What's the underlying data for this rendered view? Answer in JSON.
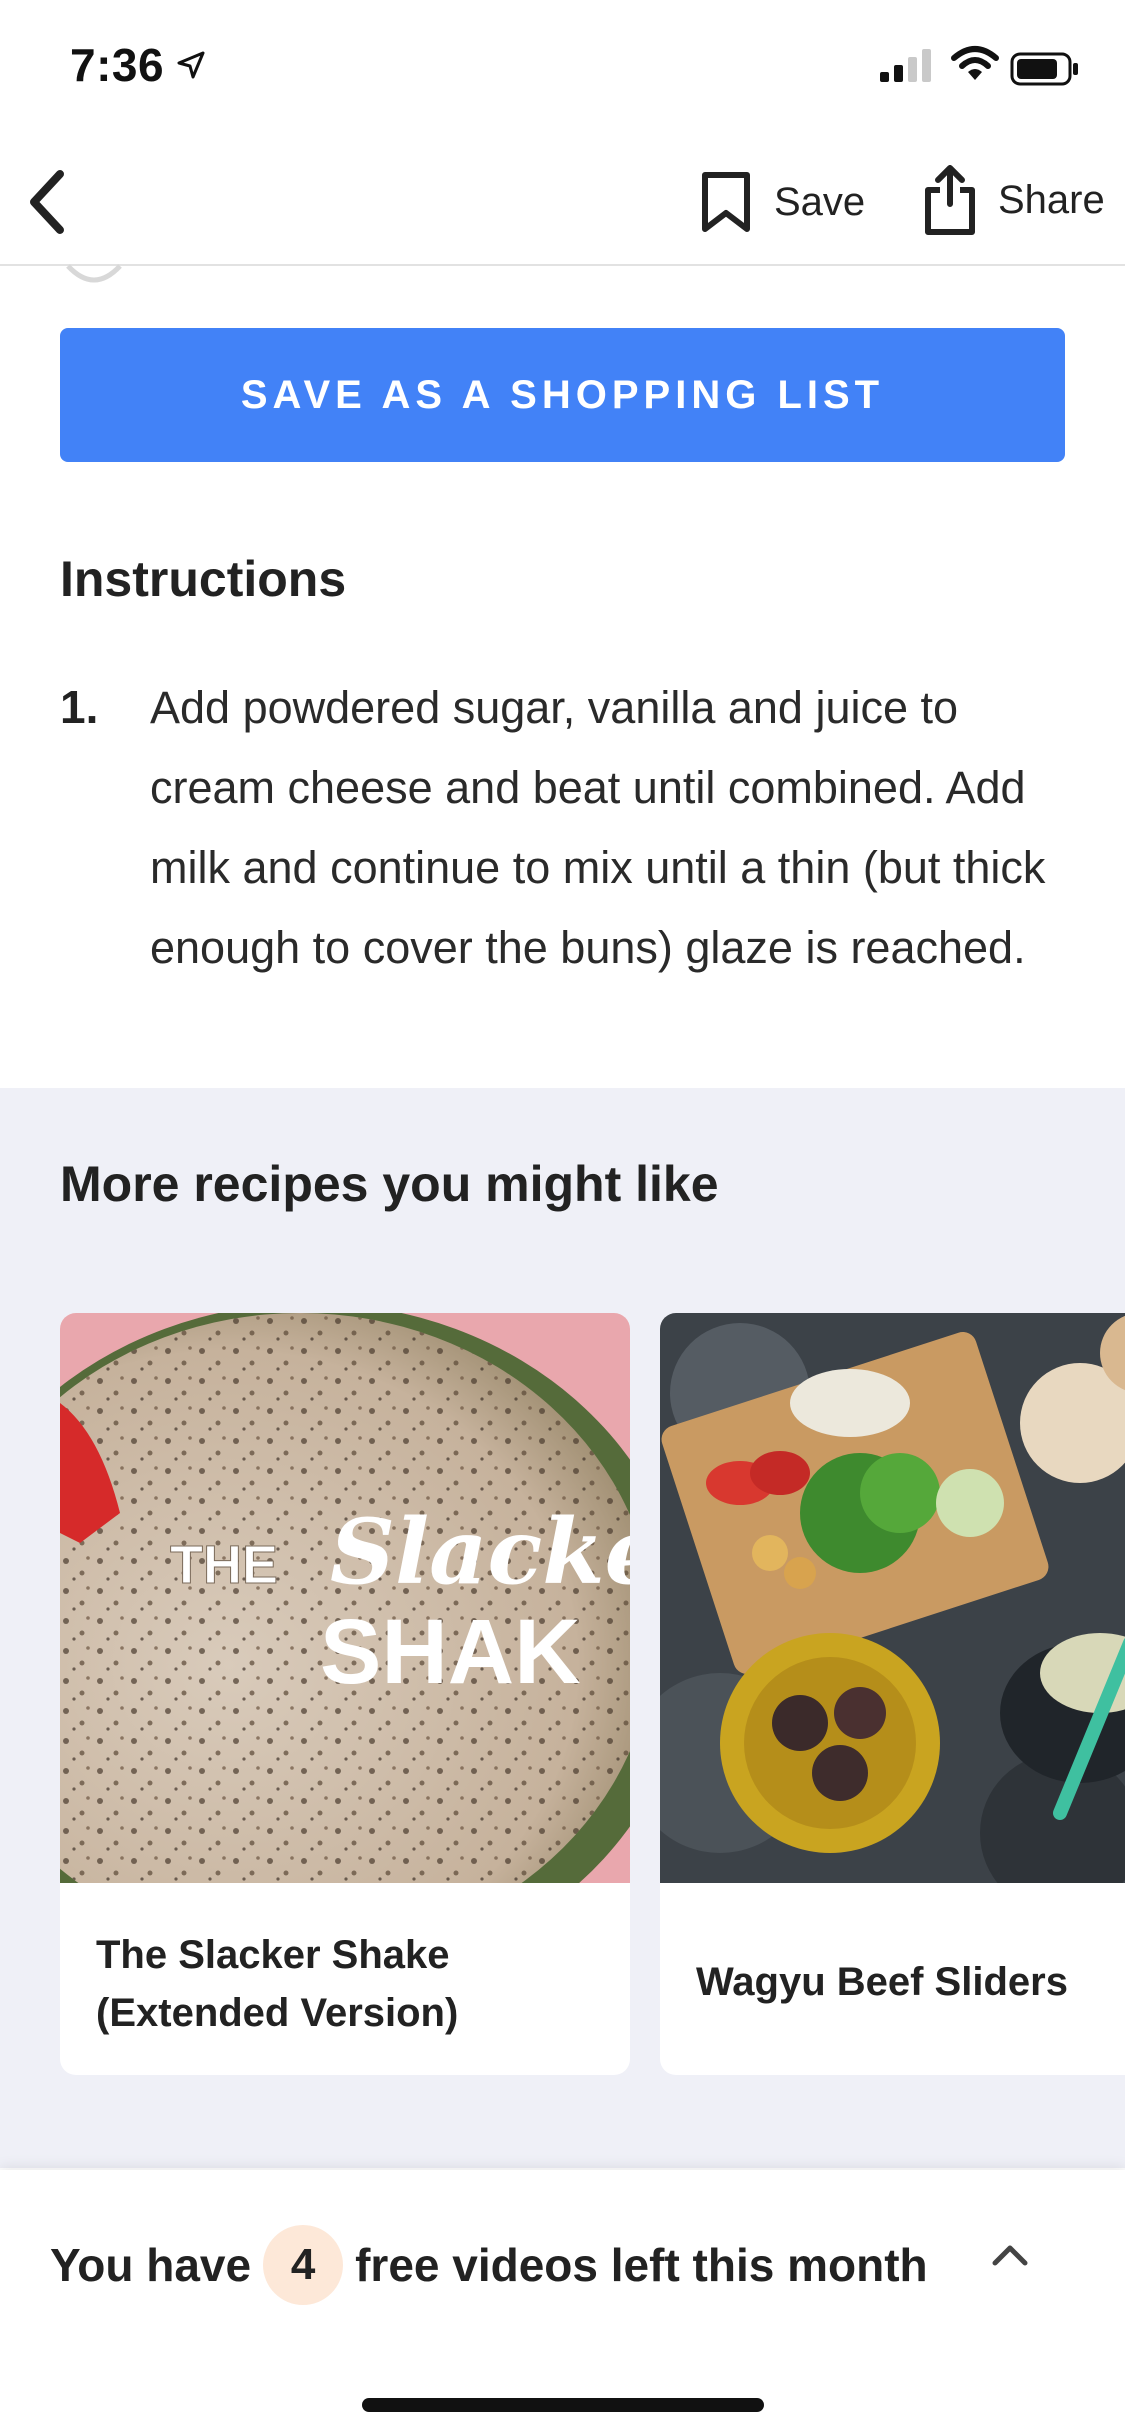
{
  "status_bar": {
    "time": "7:36"
  },
  "nav": {
    "save_label": "Save",
    "share_label": "Share"
  },
  "shopping_list_button": "SAVE AS A SHOPPING LIST",
  "instructions": {
    "title": "Instructions",
    "steps": [
      {
        "number": "1.",
        "text": "Add powdered sugar, vanilla and juice to cream cheese and beat until combined. Add milk and continue to mix until a thin (but thick enough to cover the buns) glaze is reached."
      }
    ]
  },
  "more_recipes": {
    "title": "More recipes you might like",
    "cards": [
      {
        "title_line1": "The Slacker Shake",
        "title_line2": "(Extended Version)",
        "overlay_the": "THE",
        "overlay_slacker": "Slacke",
        "overlay_shake": "SHAK"
      },
      {
        "title": "Wagyu Beef Sliders"
      }
    ]
  },
  "banner": {
    "prefix": "You have",
    "count": "4",
    "suffix": "free videos left this month"
  }
}
